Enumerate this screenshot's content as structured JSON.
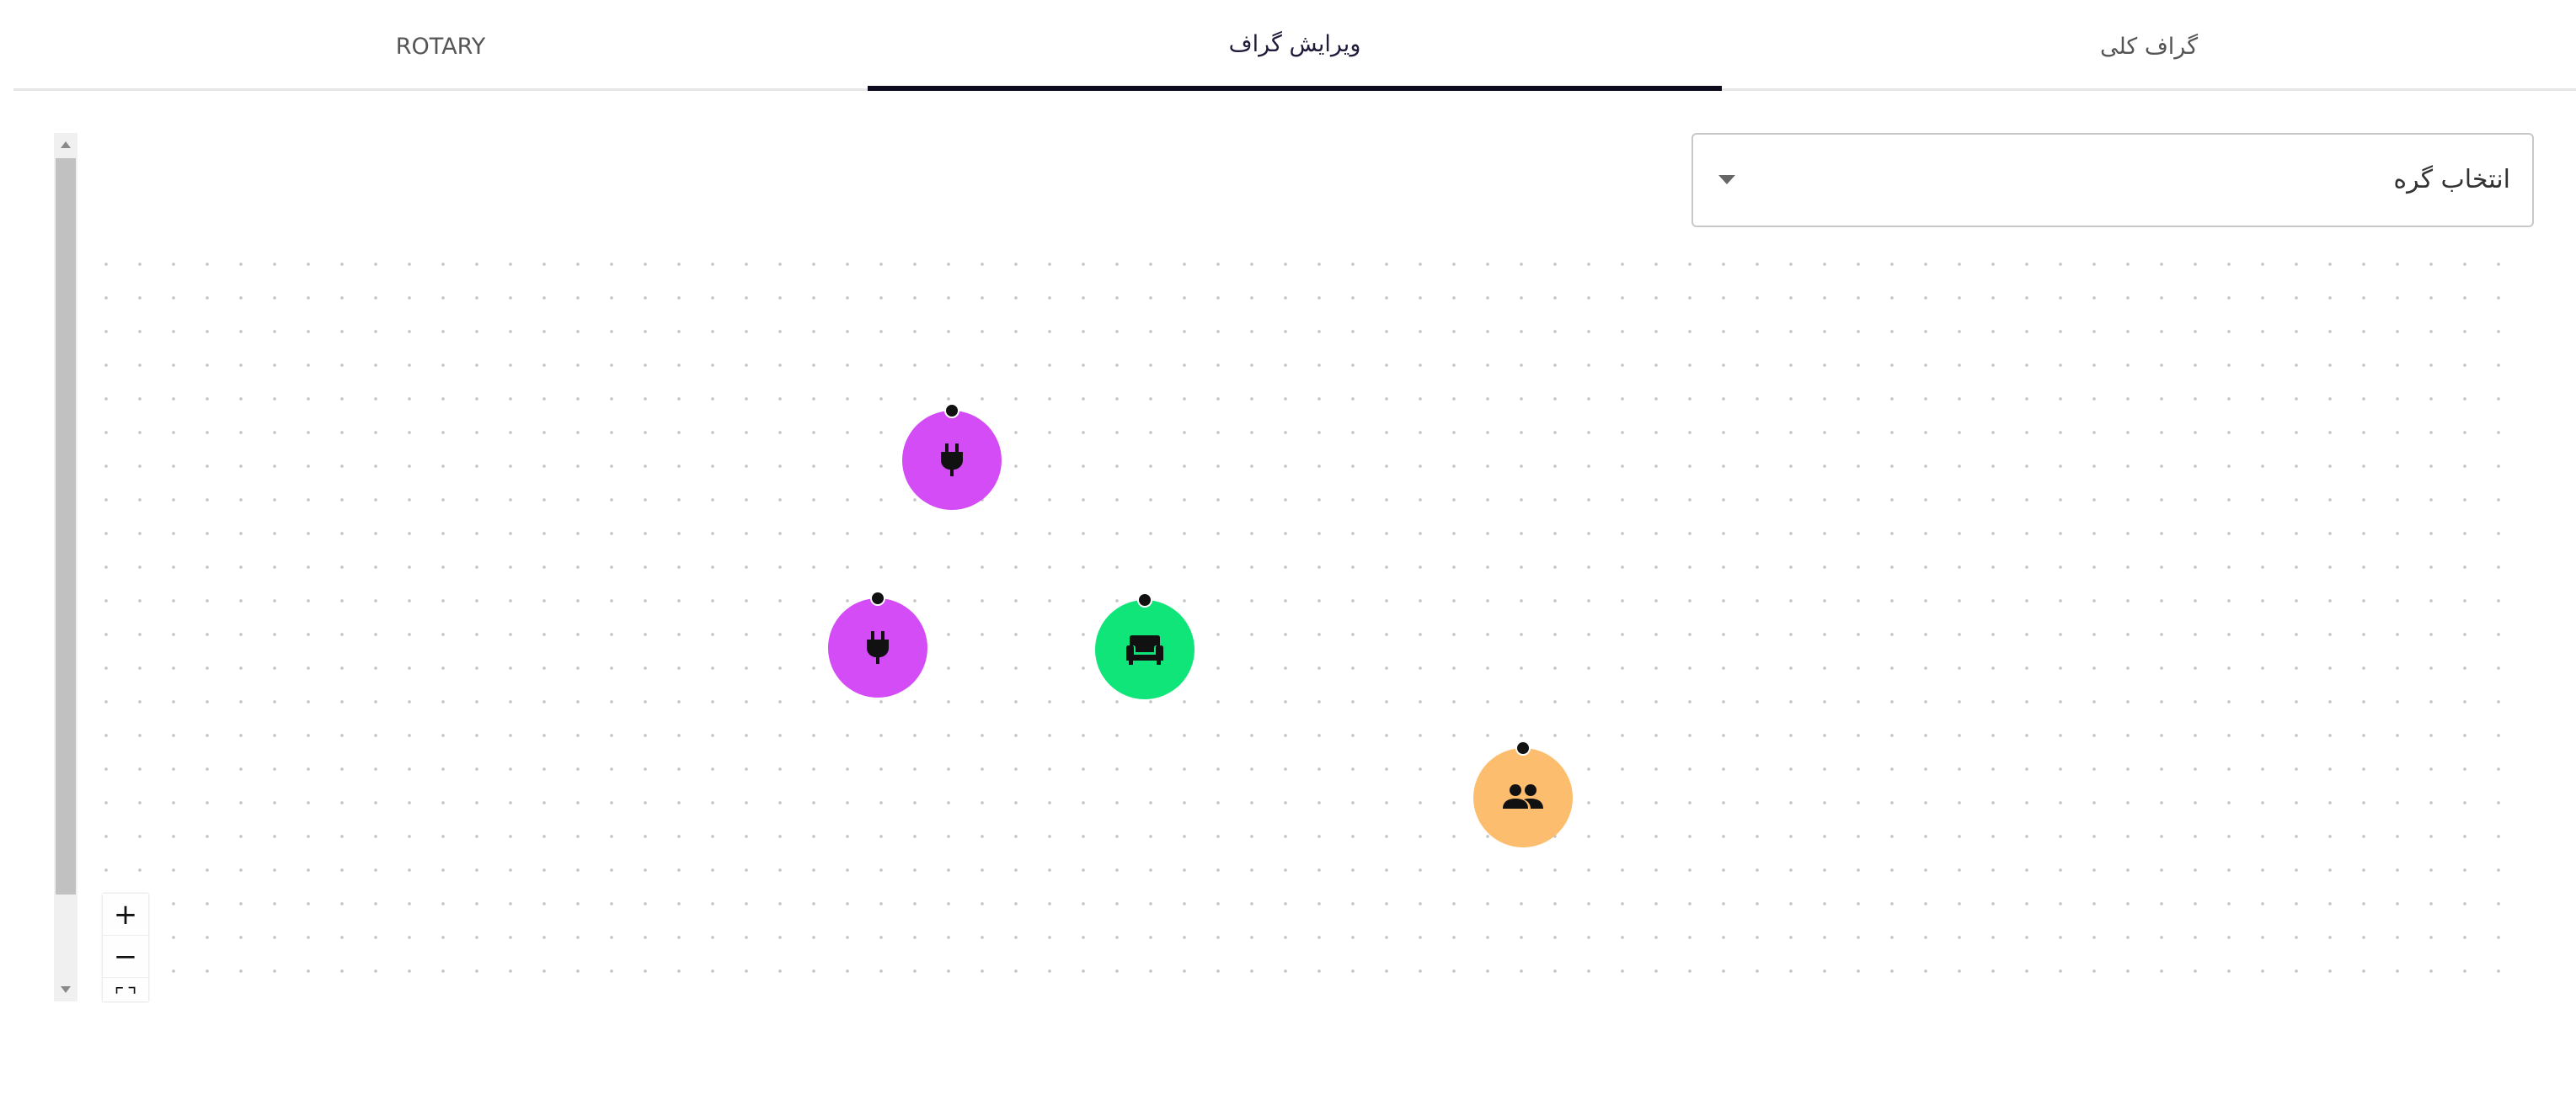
{
  "tabs": [
    {
      "label": "گراف کلی",
      "active": false
    },
    {
      "label": "ویرایش گراف",
      "active": true
    },
    {
      "label": "ROTARY",
      "active": false
    }
  ],
  "node_select": {
    "label": "انتخاب گره"
  },
  "zoom_controls": {
    "zoom_in": "+",
    "zoom_out": "−",
    "fit": "⛶"
  },
  "nodes": [
    {
      "icon": "power-plug-icon",
      "color": "#d44cf5"
    },
    {
      "icon": "power-plug-icon",
      "color": "#d44cf5"
    },
    {
      "icon": "sofa-icon",
      "color": "#10e57a"
    },
    {
      "icon": "people-group-icon",
      "color": "#fdbd6e"
    }
  ],
  "colors": {
    "accent_tab": "#0d0b1e",
    "plug_node": "#d44cf5",
    "sofa_node": "#10e57a",
    "group_node": "#fdbd6e"
  }
}
